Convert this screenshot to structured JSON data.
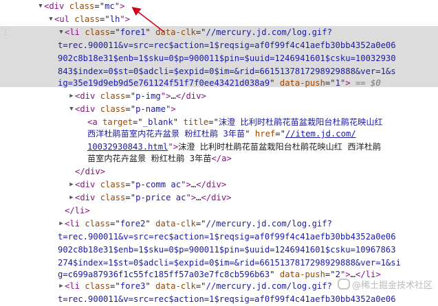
{
  "tree": {
    "row_div_mc": {
      "open": "<div ",
      "attr": "class",
      "eq": "=\"",
      "val": "mc",
      "close": "\">"
    },
    "row_ul_lh": {
      "open": "<ul ",
      "attr": "class",
      "eq": "=\"",
      "val": "lh",
      "close": "\">"
    },
    "row_li_fore1": {
      "l1_open": "<li ",
      "l1_attr1": "class",
      "l1_eq1": "=\"",
      "l1_val1": "fore1",
      "l1_q1": "\" ",
      "l1_attr2": "data-clk",
      "l1_eq2": "=\"",
      "l1_val2": "//mercury.jd.com/log.gif?",
      "l2": "t=rec.900011&v=src=rec$action=1$reqsig=af0f99f4c41aefb30bb4352a0e06",
      "l3": "902c8b18e31$enb=1$sku=0$p=900011$pin=$uuid=1246941601$csku=10032930",
      "l4": "843$index=0$st=0$adcli=$expid=0$im=&rid=6615137817298929888&ver=1&s",
      "l5_val": "ig=35e19d9eb9d5e761124f51f7f0ee43421d038a9",
      "l5_q": "\" ",
      "l5_attr": "data-push",
      "l5_eq": "=\"",
      "l5_val2": "1",
      "l5_close": "\">",
      "l5_dollar": " == $0"
    },
    "row_p_img": {
      "open": "<div ",
      "attr": "class",
      "eq": "=\"",
      "val": "p-img",
      "close": "\">",
      "ellipsis": "…",
      "end": "</div>"
    },
    "row_p_name": {
      "open": "<div ",
      "attr": "class",
      "eq": "=\"",
      "val": "p-name",
      "close": "\">"
    },
    "row_a": {
      "l1_open": "<a ",
      "l1_attr1": "target",
      "l1_eq1": "=\"",
      "l1_val1": "_blank",
      "l1_q1": "\" ",
      "l1_attr2": "title",
      "l1_eq2": "=\"",
      "l1_val2": "沫澄 比利时杜鹃花苗盆栽阳台杜鹃花映山红",
      "l2_val": "西洋杜鹃苗室内花卉盆景 粉红杜鹃 3年苗",
      "l2_q": "\" ",
      "l2_attr": "href",
      "l2_eq": "=\"",
      "l2_link": "//item.jd.com/",
      "l3_link": "10032930843.html",
      "l3_close": "\">",
      "l3_text": "沫澄 比利时杜鹃花苗盆栽阳台杜鹃花映山红 西洋杜鹃",
      "l4_text": "苗室内花卉盆景 粉红杜鹃 3年苗",
      "l4_end": "</a>"
    },
    "row_div_end_pname": "</div>",
    "row_p_comm": {
      "open": "<div ",
      "attr": "class",
      "eq": "=\"",
      "val": "p-comm ac",
      "close": "\">",
      "ellipsis": "…",
      "end": "</div>"
    },
    "row_p_price": {
      "open": "<div ",
      "attr": "class",
      "eq": "=\"",
      "val": "p-price ac",
      "close": "\">",
      "ellipsis": "…",
      "end": "</div>"
    },
    "row_li_end": "</li>",
    "row_li_fore2": {
      "l1_open": "<li ",
      "l1_attr1": "class",
      "l1_eq1": "=\"",
      "l1_val1": "fore2",
      "l1_q1": "\" ",
      "l1_attr2": "data-clk",
      "l1_eq2": "=\"",
      "l1_val2": "//mercury.jd.com/log.gif?",
      "l2": "t=rec.900011&v=src=rec$action=1$reqsig=af0f99f4c41aefb30bb4352a0e06",
      "l3": "902c8b18e31$enb=1$sku=0$p=900011$pin=$uuid=1246941601$csku=10967863",
      "l4": "274$index=1$st=0$adcli=$expid=0$im=&rid=6615137817298929888&ver=1&si",
      "l5_val": "g=c699a87936f1c55fc185ff57a03e7fc8cb596b63",
      "l5_q": "\" ",
      "l5_attr": "data-push",
      "l5_eq": "=\"",
      "l5_val2": "2",
      "l5_close": "\">",
      "l5_ellipsis": "…",
      "l5_end": "</li>"
    },
    "row_li_fore3": {
      "l1_open": "<li ",
      "l1_attr1": "class",
      "l1_eq1": "=\"",
      "l1_val1": "fore3",
      "l1_q1": "\" ",
      "l1_attr2": "data-clk",
      "l1_eq2": "=\"",
      "l1_val2": "//mercury.jd.com/log.gif?",
      "l2": "t=rec.900011&v=src=rec$action=1$reqsig=af0f99f4c41aefb30bb4352a0e06"
    }
  },
  "gutter_dots": "⋮",
  "watermark": "@稀土掘金技术社区",
  "icons": {
    "expanded": "triangle-down-icon",
    "collapsed": "triangle-right-icon"
  },
  "colors": {
    "tag": "#881280",
    "attr": "#994500",
    "value": "#1a1aa6",
    "highlight": "#dcdcdc",
    "arrow": "#d0021b"
  }
}
